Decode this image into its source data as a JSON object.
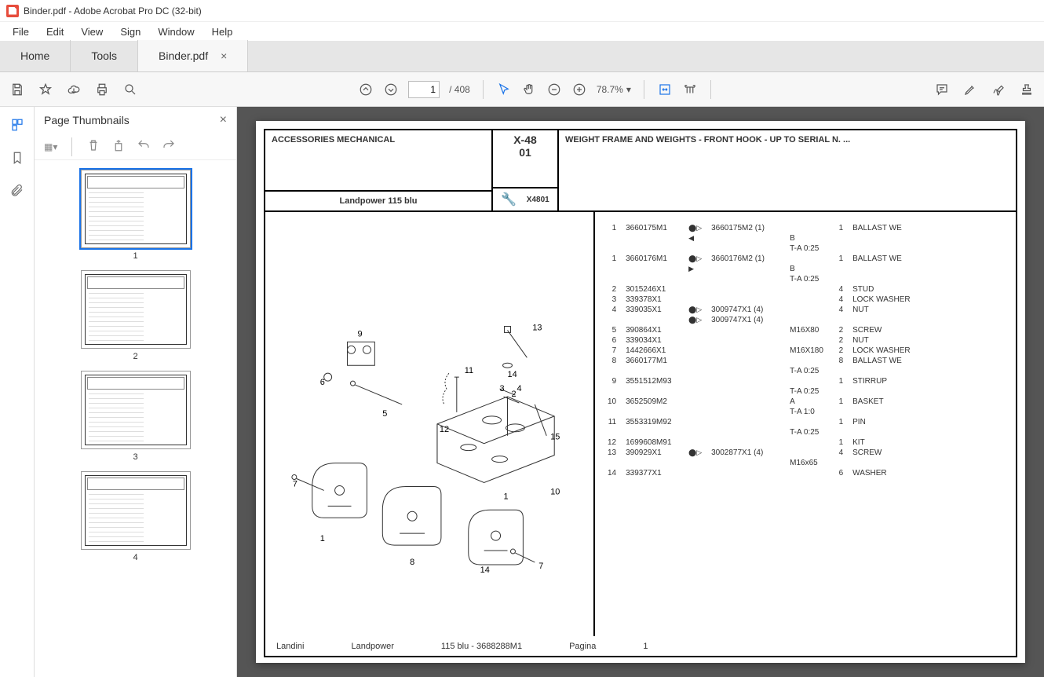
{
  "titlebar": "Binder.pdf - Adobe Acrobat Pro DC (32-bit)",
  "menu": [
    "File",
    "Edit",
    "View",
    "Sign",
    "Window",
    "Help"
  ],
  "tabs": {
    "home": "Home",
    "tools": "Tools",
    "doc": "Binder.pdf"
  },
  "toolbar": {
    "page_current": "1",
    "page_total": "/  408",
    "zoom": "78.7%"
  },
  "thumbpanel": {
    "title": "Page Thumbnails",
    "labels": [
      "1",
      "2",
      "3",
      "4"
    ]
  },
  "doc": {
    "header": {
      "category": "ACCESSORIES MECHANICAL",
      "model": "Landpower 115 blu",
      "code_top": "X-48",
      "code_bot": "01",
      "code_sub": "X4801",
      "title": "WEIGHT FRAME AND WEIGHTS - FRONT HOOK - UP TO SERIAL N. ..."
    },
    "parts": [
      {
        "n": "1",
        "pn": "3660175M1",
        "sym": "⬤▷",
        "alt": "3660175M2  (1)",
        "note": "",
        "q": "1",
        "desc": "BALLAST WE"
      },
      {
        "n": "",
        "pn": "",
        "sym": "◀",
        "alt": "",
        "note": "B",
        "q": "",
        "desc": ""
      },
      {
        "n": "",
        "pn": "",
        "sym": "",
        "alt": "",
        "note": "T-A 0:25",
        "q": "",
        "desc": ""
      },
      {
        "n": "1",
        "pn": "3660176M1",
        "sym": "⬤▷",
        "alt": "3660176M2  (1)",
        "note": "",
        "q": "1",
        "desc": "BALLAST WE"
      },
      {
        "n": "",
        "pn": "",
        "sym": "▶",
        "alt": "",
        "note": "B",
        "q": "",
        "desc": ""
      },
      {
        "n": "",
        "pn": "",
        "sym": "",
        "alt": "",
        "note": "T-A 0:25",
        "q": "",
        "desc": ""
      },
      {
        "n": "2",
        "pn": "3015246X1",
        "sym": "",
        "alt": "",
        "note": "",
        "q": "4",
        "desc": "STUD"
      },
      {
        "n": "3",
        "pn": "339378X1",
        "sym": "",
        "alt": "",
        "note": "",
        "q": "4",
        "desc": "LOCK WASHER"
      },
      {
        "n": "4",
        "pn": "339035X1",
        "sym": "⬤▷",
        "alt": "3009747X1  (4)",
        "note": "",
        "q": "4",
        "desc": "NUT"
      },
      {
        "n": "",
        "pn": "",
        "sym": "⬤▷",
        "alt": "3009747X1  (4)",
        "note": "",
        "q": "",
        "desc": ""
      },
      {
        "n": "5",
        "pn": "390864X1",
        "sym": "",
        "alt": "",
        "note": "M16X80",
        "q": "2",
        "desc": "SCREW"
      },
      {
        "n": "6",
        "pn": "339034X1",
        "sym": "",
        "alt": "",
        "note": "",
        "q": "2",
        "desc": "NUT"
      },
      {
        "n": "7",
        "pn": "1442666X1",
        "sym": "",
        "alt": "",
        "note": "M16X180",
        "q": "2",
        "desc": "LOCK WASHER"
      },
      {
        "n": "8",
        "pn": "3660177M1",
        "sym": "",
        "alt": "",
        "note": "",
        "q": "8",
        "desc": "BALLAST WE"
      },
      {
        "n": "",
        "pn": "",
        "sym": "",
        "alt": "",
        "note": "T-A 0:25",
        "q": "",
        "desc": ""
      },
      {
        "n": "9",
        "pn": "3551512M93",
        "sym": "",
        "alt": "",
        "note": "",
        "q": "1",
        "desc": "STIRRUP"
      },
      {
        "n": "",
        "pn": "",
        "sym": "",
        "alt": "",
        "note": "T-A 0:25",
        "q": "",
        "desc": ""
      },
      {
        "n": "10",
        "pn": "3652509M2",
        "sym": "",
        "alt": "",
        "note": "A",
        "q": "1",
        "desc": "BASKET"
      },
      {
        "n": "",
        "pn": "",
        "sym": "",
        "alt": "",
        "note": "T-A 1:0",
        "q": "",
        "desc": ""
      },
      {
        "n": "11",
        "pn": "3553319M92",
        "sym": "",
        "alt": "",
        "note": "",
        "q": "1",
        "desc": "PIN"
      },
      {
        "n": "",
        "pn": "",
        "sym": "",
        "alt": "",
        "note": "T-A 0:25",
        "q": "",
        "desc": ""
      },
      {
        "n": "12",
        "pn": "1699608M91",
        "sym": "",
        "alt": "",
        "note": "",
        "q": "1",
        "desc": "KIT"
      },
      {
        "n": "13",
        "pn": "390929X1",
        "sym": "⬤▷",
        "alt": "3002877X1  (4)",
        "note": "",
        "q": "4",
        "desc": "SCREW"
      },
      {
        "n": "",
        "pn": "",
        "sym": "",
        "alt": "",
        "note": "M16x65",
        "q": "",
        "desc": ""
      },
      {
        "n": "14",
        "pn": "339377X1",
        "sym": "",
        "alt": "",
        "note": "",
        "q": "6",
        "desc": "WASHER"
      }
    ],
    "footer": {
      "a": "Landini",
      "b": "Landpower",
      "c": "115 blu - 3688288M1",
      "d": "Pagina",
      "e": "1"
    },
    "callouts": [
      "1",
      "2",
      "3",
      "4",
      "5",
      "6",
      "7",
      "8",
      "9",
      "10",
      "11",
      "12",
      "13",
      "14",
      "15"
    ]
  }
}
